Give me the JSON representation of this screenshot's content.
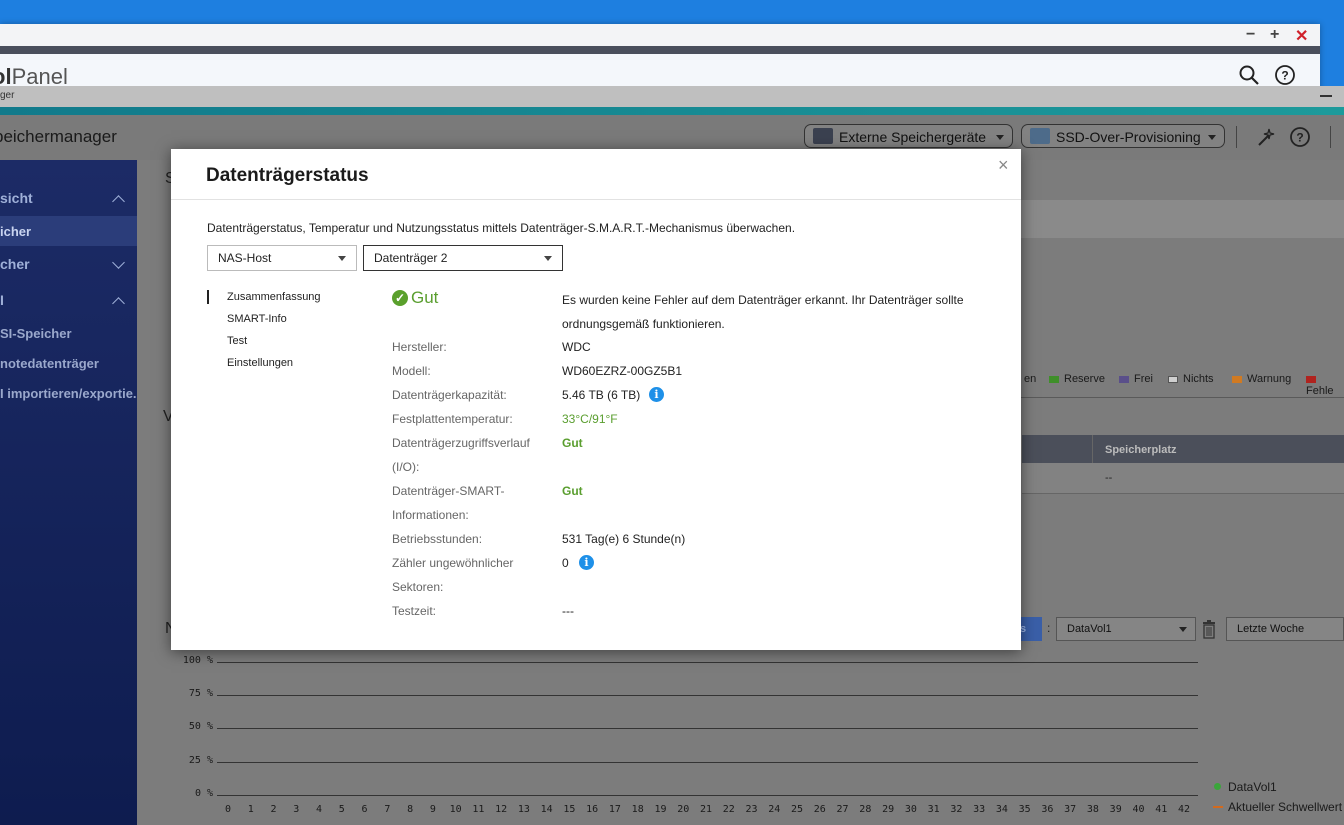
{
  "control_panel": {
    "logo_bold": "ol",
    "logo_light": "Panel",
    "window_buttons": [
      "−",
      "+",
      "✕"
    ]
  },
  "app": {
    "small_title": "ger",
    "name": "peichermanager",
    "external_devices_label": "Externe Speichergeräte",
    "ssd_label": "SSD-Over-Provisioning"
  },
  "sidebar": {
    "items": [
      {
        "label": "sicht"
      },
      {
        "label": "icher"
      },
      {
        "label": "cher"
      },
      {
        "label": "I"
      },
      {
        "label": "SI-Speicher"
      },
      {
        "label": "notedatenträger"
      },
      {
        "label": "I importieren/exportie..."
      }
    ]
  },
  "background": {
    "section_letter_1": "S",
    "section_letter_2": "V",
    "section_letter_3": "N",
    "legend": [
      {
        "label": "en",
        "color": ""
      },
      {
        "label": "Reserve",
        "color": "#3f8f2a"
      },
      {
        "label": "Frei",
        "color": "#5a4f8a"
      },
      {
        "label": "Nichts",
        "color": "#cfcfcf"
      },
      {
        "label": "Warnung",
        "color": "#d07a22"
      },
      {
        "label": "Fehle",
        "color": "#b0231f"
      }
    ],
    "table_header": "Speicherplatz",
    "table_cell": "--",
    "button_partial": "s",
    "volume_select": "DataVol1",
    "period_select": "Letzte Woche",
    "separator": ":"
  },
  "chart_data": {
    "type": "line",
    "y_ticks": [
      "100 %",
      "75 %",
      "50 %",
      "25 %",
      "0 %"
    ],
    "x": [
      0,
      1,
      2,
      3,
      4,
      5,
      6,
      7,
      8,
      9,
      10,
      11,
      12,
      13,
      14,
      15,
      16,
      17,
      18,
      19,
      20,
      21,
      22,
      23,
      24,
      25,
      26,
      27,
      28,
      29,
      30,
      31,
      32,
      33,
      34,
      35,
      36,
      37,
      38,
      39,
      40,
      41,
      42
    ],
    "ylim": [
      0,
      100
    ],
    "series": [
      {
        "name": "DataVol1",
        "values": [],
        "color": "#3aa63a"
      },
      {
        "name": "Aktueller Schwellwert",
        "values": [],
        "color": "#d46a1c"
      }
    ],
    "legend": [
      "DataVol1",
      "Aktueller Schwellwert"
    ]
  },
  "modal": {
    "title": "Datenträgerstatus",
    "description": "Datenträgerstatus, Temperatur und Nutzungsstatus mittels Datenträger-S.M.A.R.T.-Mechanismus überwachen.",
    "host_select": "NAS-Host",
    "disk_select": "Datenträger 2",
    "nav": [
      "Zusammenfassung",
      "SMART-Info",
      "Test",
      "Einstellungen"
    ],
    "status": "Gut",
    "summary": "Es wurden keine Fehler auf dem Datenträger erkannt. Ihr Datenträger sollte ordnungsgemäß funktionieren.",
    "fields": {
      "manufacturer_label": "Hersteller:",
      "manufacturer": "WDC",
      "model_label": "Modell:",
      "model": "WD60EZRZ-00GZ5B1",
      "capacity_label": "Datenträgerkapazität:",
      "capacity": "5.46 TB (6 TB)",
      "temp_label": "Festplattentemperatur:",
      "temp": "33°C/91°F",
      "access_label_1": "Datenträgerzugriffsverlauf",
      "access_label_2": "(I/O):",
      "access": "Gut",
      "smart_label_1": "Datenträger-SMART-",
      "smart_label_2": "Informationen:",
      "smart": "Gut",
      "hours_label": "Betriebsstunden:",
      "hours": "531 Tag(e) 6 Stunde(n)",
      "sectors_label_1": "Zähler ungewöhnlicher",
      "sectors_label_2": "Sektoren:",
      "sectors": "0",
      "testtime_label": "Testzeit:",
      "testtime": "---"
    },
    "close": "×",
    "info_glyph": "i",
    "check_glyph": "✓"
  }
}
